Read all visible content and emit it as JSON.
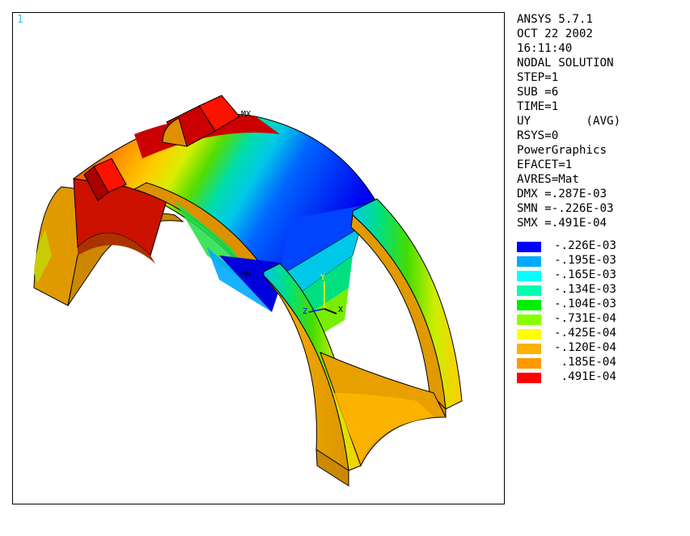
{
  "window_number": "1",
  "info_lines": [
    "ANSYS 5.7.1",
    "OCT 22 2002",
    "16:11:40",
    "NODAL SOLUTION",
    "STEP=1",
    "SUB =6",
    "TIME=1",
    "UY        (AVG)",
    "RSYS=0",
    "PowerGraphics",
    "EFACET=1",
    "AVRES=Mat",
    "DMX =.287E-03",
    "SMN =-.226E-03",
    "SMX =.491E-04"
  ],
  "legend": [
    {
      "value": "-.226E-03",
      "color": "#0000ff"
    },
    {
      "value": "-.195E-03",
      "color": "#00aaff"
    },
    {
      "value": "-.165E-03",
      "color": "#00ffff"
    },
    {
      "value": "-.134E-03",
      "color": "#00ffb0"
    },
    {
      "value": "-.104E-03",
      "color": "#00ee00"
    },
    {
      "value": "-.731E-04",
      "color": "#88ff00"
    },
    {
      "value": "-.425E-04",
      "color": "#ffff00"
    },
    {
      "value": "-.120E-04",
      "color": "#ffb000"
    },
    {
      "value": ".185E-04",
      "color": "#ff9900"
    },
    {
      "value": ".491E-04",
      "color": "#ff0000"
    }
  ],
  "model_labels": {
    "max_marker": "MX",
    "min_marker": "MN",
    "axis_y": "Y",
    "axis_x": "X",
    "axis_z": "Z"
  }
}
